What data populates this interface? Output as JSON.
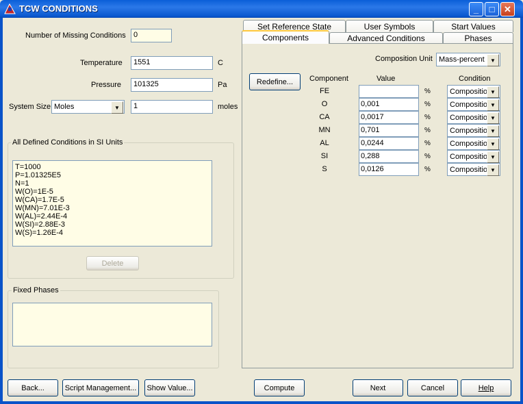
{
  "window": {
    "title": "TCW CONDITIONS",
    "controls": {
      "minimize": "_",
      "maximize": "□",
      "close": "✕"
    }
  },
  "missing": {
    "label": "Number of Missing Conditions",
    "value": "0"
  },
  "temperature": {
    "label": "Temperature",
    "value": "1551",
    "unit": "C"
  },
  "pressure": {
    "label": "Pressure",
    "value": "101325",
    "unit": "Pa"
  },
  "system_size": {
    "label": "System Size",
    "selected": "Moles",
    "value": "1",
    "unit": "moles"
  },
  "si_conditions": {
    "title": "All Defined Conditions in SI Units",
    "lines": [
      "T=1000",
      "P=1.01325E5",
      "N=1",
      "W(O)=1E-5",
      "W(CA)=1.7E-5",
      "W(MN)=7.01E-3",
      "W(AL)=2.44E-4",
      "W(SI)=2.88E-3",
      "W(S)=1.26E-4"
    ],
    "delete_label": "Delete"
  },
  "fixed_phases": {
    "title": "Fixed Phases"
  },
  "tabs": {
    "row_back": [
      "Set Reference State",
      "User Symbols",
      "Start Values"
    ],
    "row_front": [
      "Components",
      "Advanced Conditions",
      "Phases"
    ],
    "active": "Components"
  },
  "components_tab": {
    "unit_label": "Composition Unit",
    "unit_value": "Mass-percent",
    "redefine_label": "Redefine...",
    "headers": {
      "component": "Component",
      "value": "Value",
      "condition": "Condition"
    },
    "rows": [
      {
        "name": "FE",
        "value": "",
        "unit": "%",
        "condition": "Composition"
      },
      {
        "name": "O",
        "value": "0,001",
        "unit": "%",
        "condition": "Composition"
      },
      {
        "name": "CA",
        "value": "0,0017",
        "unit": "%",
        "condition": "Composition"
      },
      {
        "name": "MN",
        "value": "0,701",
        "unit": "%",
        "condition": "Composition"
      },
      {
        "name": "AL",
        "value": "0,0244",
        "unit": "%",
        "condition": "Composition"
      },
      {
        "name": "SI",
        "value": "0,288",
        "unit": "%",
        "condition": "Composition"
      },
      {
        "name": "S",
        "value": "0,0126",
        "unit": "%",
        "condition": "Composition"
      }
    ]
  },
  "bottom_buttons": {
    "back": "Back...",
    "script": "Script Management...",
    "show_value": "Show Value...",
    "compute": "Compute",
    "next": "Next",
    "cancel": "Cancel",
    "help": "Help"
  },
  "colors": {
    "titlebar": "#0a5fd8",
    "window_bg": "#ece9d8",
    "field_highlight": "#fffde6",
    "active_tab_accent": "#ffc83c"
  }
}
